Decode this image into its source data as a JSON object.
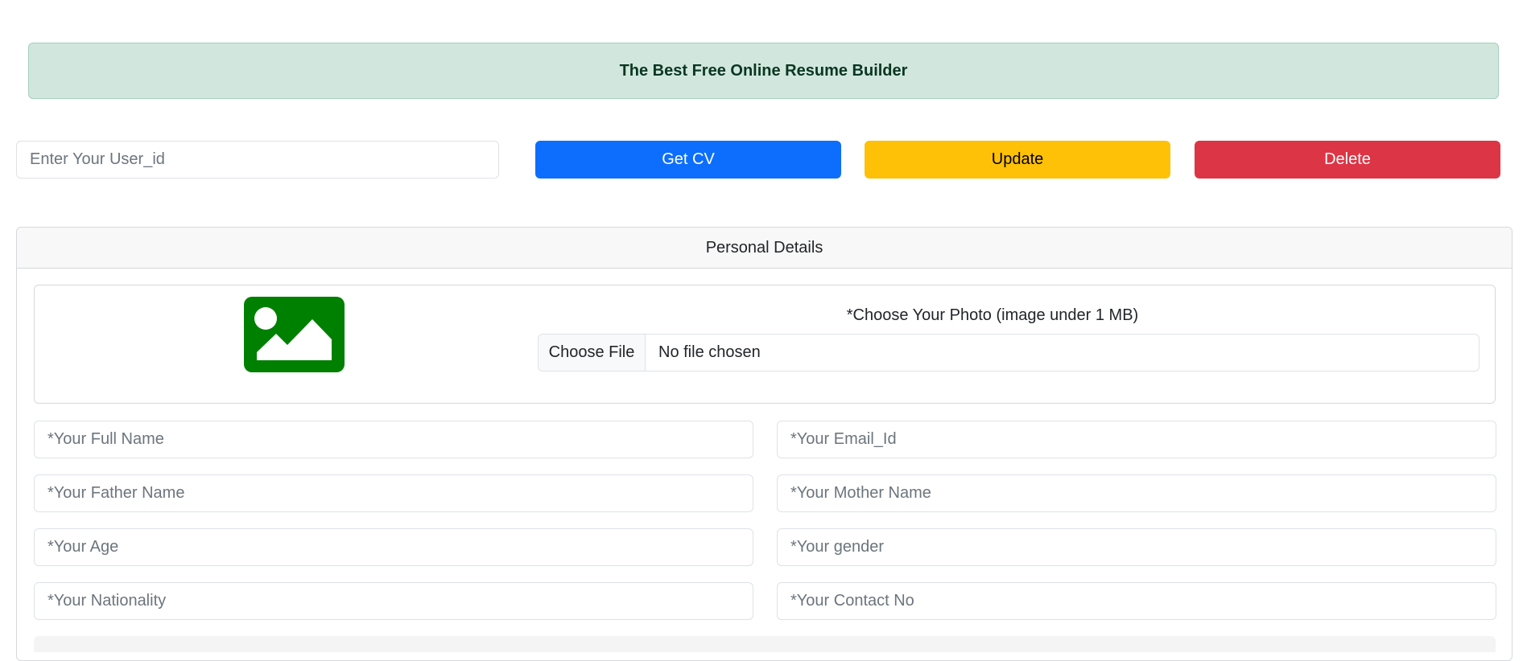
{
  "banner": {
    "title": "The Best Free Online Resume Builder"
  },
  "toolbar": {
    "userid_placeholder": "Enter Your User_id",
    "get_cv_label": "Get CV",
    "update_label": "Update",
    "delete_label": "Delete"
  },
  "personal_details": {
    "header": "Personal Details",
    "photo": {
      "label": "*Choose Your Photo (image under 1 MB)",
      "choose_file_label": "Choose File",
      "file_status": "No file chosen",
      "icon": "image-icon"
    },
    "fields": {
      "full_name": "*Your Full Name",
      "email": "*Your Email_Id",
      "father_name": "*Your Father Name",
      "mother_name": "*Your Mother Name",
      "age": "*Your Age",
      "gender": "*Your gender",
      "nationality": "*Your Nationality",
      "contact_no": "*Your Contact No"
    }
  },
  "colors": {
    "primary": "#0d6efd",
    "warning": "#ffc107",
    "danger": "#dc3545",
    "success_bg": "#d1e7dd",
    "icon_green": "#008000"
  }
}
